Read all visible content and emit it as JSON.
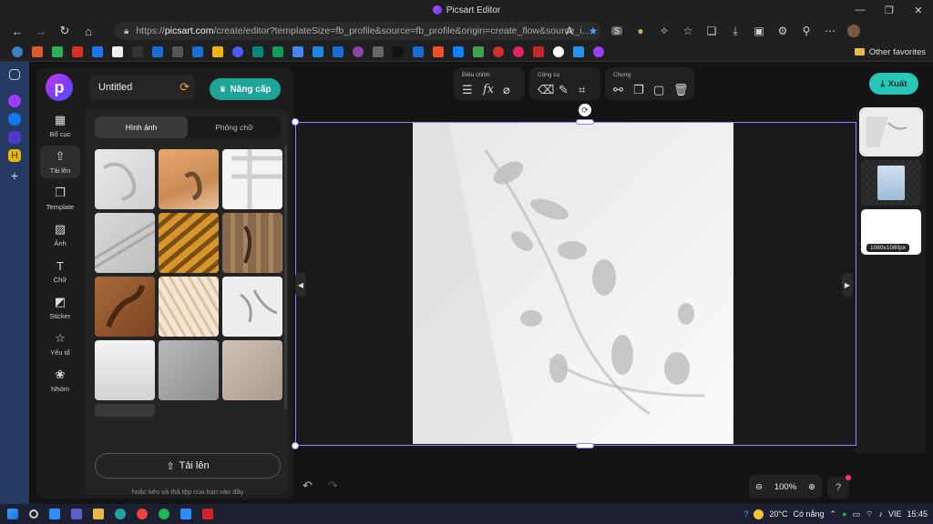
{
  "browser": {
    "window_title": "Picsart Editor",
    "url_prefix": "https://",
    "url_domain": "picsart.com",
    "url_rest": "/create/editor?templateSize=fb_profile&source=fb_profile&origin=create_flow&source_i...",
    "other_favorites": "Other favorites"
  },
  "editor": {
    "title": "Untitled",
    "upgrade_label": "Nâng cấp",
    "export_label": "Xuất",
    "toolbar": {
      "adjust_label": "Điều chỉnh",
      "tools_label": "Công cụ",
      "general_label": "Chung"
    },
    "rail": [
      {
        "label": "Bố cục",
        "icon": "layout-icon"
      },
      {
        "label": "Tải lên",
        "icon": "upload-icon"
      },
      {
        "label": "Template",
        "icon": "template-icon"
      },
      {
        "label": "Ảnh",
        "icon": "image-icon"
      },
      {
        "label": "Chữ",
        "icon": "text-icon"
      },
      {
        "label": "Sticker",
        "icon": "sticker-icon"
      },
      {
        "label": "Yếu tố",
        "icon": "star-icon"
      },
      {
        "label": "Nhóm",
        "icon": "group-icon"
      }
    ],
    "upload_panel": {
      "tab_images": "Hình ảnh",
      "tab_fonts": "Phông chữ",
      "upload_button": "Tải lên",
      "hint": "hoặc kéo và thả tệp của bạn vào đây"
    },
    "page_size": "1080x1080px",
    "zoom": "100%"
  },
  "taskbar": {
    "weather": "20°C",
    "weather_desc": "Có nắng",
    "lang": "VIE",
    "time": "15:45"
  },
  "colors": {
    "accent_teal": "#1ea598",
    "export_teal": "#27c8b8",
    "selection_purple": "#9c7cff"
  }
}
